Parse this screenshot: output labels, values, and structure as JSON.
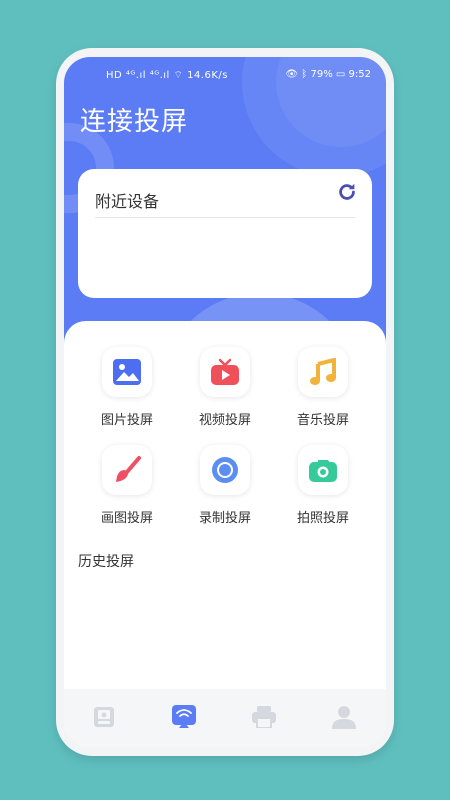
{
  "status_bar": {
    "left": "HD ⁴ᴳ.ıl ⁴ᴳ.ıl ⌔ 14.6K/s",
    "battery": "79%",
    "time": "9:52"
  },
  "header": {
    "title": "连接投屏"
  },
  "nearby": {
    "label": "附近设备",
    "refresh_icon": "refresh-icon"
  },
  "features": [
    {
      "label": "图片投屏",
      "icon": "image-icon",
      "color": "#4e6ef2"
    },
    {
      "label": "视频投屏",
      "icon": "tv-icon",
      "color": "#f0505a"
    },
    {
      "label": "音乐投屏",
      "icon": "music-note-icon",
      "color": "#f2b33d"
    },
    {
      "label": "画图投屏",
      "icon": "paintbrush-icon",
      "color": "#ef4f63"
    },
    {
      "label": "录制投屏",
      "icon": "record-circle-icon",
      "color": "#5b8ef0"
    },
    {
      "label": "拍照投屏",
      "icon": "camera-icon",
      "color": "#36c99a"
    }
  ],
  "history": {
    "label": "历史投屏"
  },
  "tabbar": [
    {
      "icon": "photo-frame-icon",
      "active": false
    },
    {
      "icon": "cast-icon",
      "active": true
    },
    {
      "icon": "printer-icon",
      "active": false
    },
    {
      "icon": "user-icon",
      "active": false
    }
  ],
  "colors": {
    "accent": "#5b7cf5",
    "background": "#5fbfbf",
    "inactive": "#d5d8de"
  }
}
